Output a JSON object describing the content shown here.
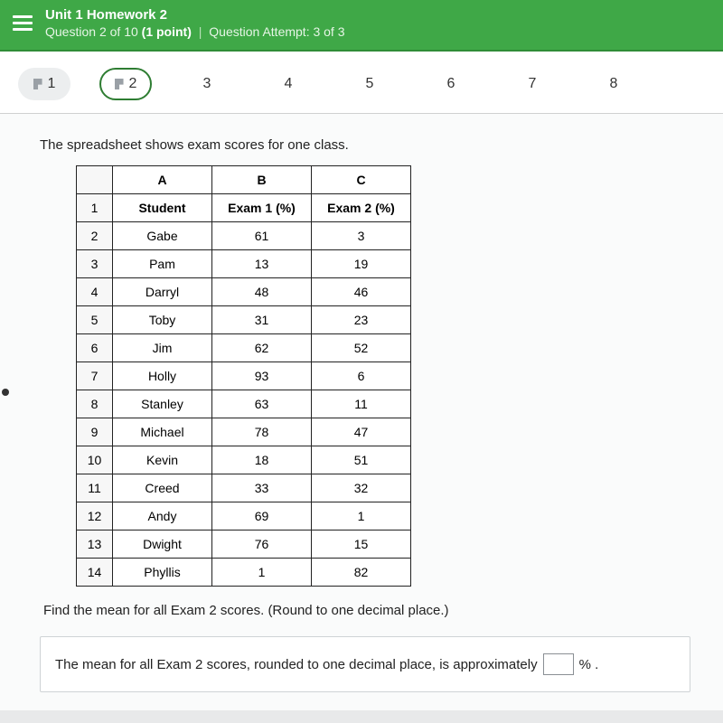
{
  "header": {
    "unit_title": "Unit 1 Homework 2",
    "question_prefix": "Question ",
    "question_num": "2",
    "question_of": " of 10 ",
    "question_points": "(1 point)",
    "attempt_label": "Question Attempt: ",
    "attempt_value": "3 of 3"
  },
  "tabs": [
    {
      "label": "1",
      "state": "answered flagged"
    },
    {
      "label": "2",
      "state": "current flagged"
    },
    {
      "label": "3",
      "state": ""
    },
    {
      "label": "4",
      "state": ""
    },
    {
      "label": "5",
      "state": ""
    },
    {
      "label": "6",
      "state": ""
    },
    {
      "label": "7",
      "state": ""
    },
    {
      "label": "8",
      "state": ""
    }
  ],
  "prompt": "The spreadsheet shows exam scores for one class.",
  "columns": {
    "A": "A",
    "B": "B",
    "C": "C"
  },
  "header_row": {
    "n": "1",
    "A": "Student",
    "B": "Exam 1 (%)",
    "C": "Exam 2 (%)"
  },
  "rows": [
    {
      "n": "2",
      "A": "Gabe",
      "B": "61",
      "C": "3"
    },
    {
      "n": "3",
      "A": "Pam",
      "B": "13",
      "C": "19"
    },
    {
      "n": "4",
      "A": "Darryl",
      "B": "48",
      "C": "46"
    },
    {
      "n": "5",
      "A": "Toby",
      "B": "31",
      "C": "23"
    },
    {
      "n": "6",
      "A": "Jim",
      "B": "62",
      "C": "52"
    },
    {
      "n": "7",
      "A": "Holly",
      "B": "93",
      "C": "6"
    },
    {
      "n": "8",
      "A": "Stanley",
      "B": "63",
      "C": "11"
    },
    {
      "n": "9",
      "A": "Michael",
      "B": "78",
      "C": "47"
    },
    {
      "n": "10",
      "A": "Kevin",
      "B": "18",
      "C": "51"
    },
    {
      "n": "11",
      "A": "Creed",
      "B": "33",
      "C": "32"
    },
    {
      "n": "12",
      "A": "Andy",
      "B": "69",
      "C": "1"
    },
    {
      "n": "13",
      "A": "Dwight",
      "B": "76",
      "C": "15"
    },
    {
      "n": "14",
      "A": "Phyllis",
      "B": "1",
      "C": "82"
    }
  ],
  "instruction": "Find the mean for all Exam 2 scores. (Round to one decimal place.)",
  "answer": {
    "lead": "The mean for all Exam 2 scores, rounded to one decimal place, is approximately",
    "unit": "% ."
  }
}
